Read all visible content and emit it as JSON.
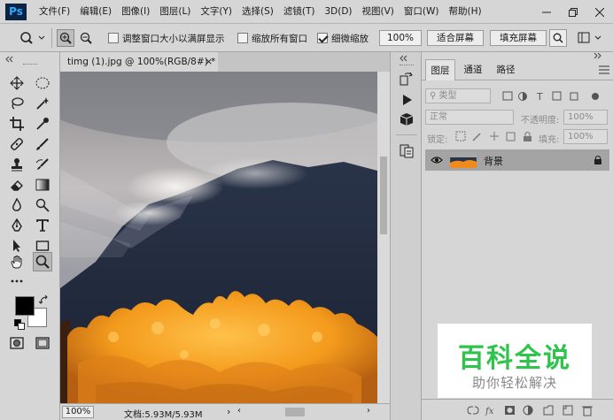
{
  "app": {
    "logo": "Ps"
  },
  "menu": [
    "文件(F)",
    "编辑(E)",
    "图像(I)",
    "图层(L)",
    "文字(Y)",
    "选择(S)",
    "滤镜(T)",
    "3D(D)",
    "视图(V)",
    "窗口(W)",
    "帮助(H)"
  ],
  "options": {
    "resize_windows": "调整窗口大小以满屏显示",
    "resize_windows_checked": false,
    "zoom_all": "缩放所有窗口",
    "zoom_all_checked": false,
    "scrubby_zoom": "细微缩放",
    "scrubby_zoom_checked": true,
    "zoom_value": "100%",
    "fit_screen": "适合屏幕",
    "fill_screen": "填充屏幕"
  },
  "document": {
    "tab_title": "timg (1).jpg @ 100%(RGB/8#) *",
    "close_glyph": "×"
  },
  "status": {
    "zoom": "100%",
    "doc_label": "文档:5.93M/5.93M"
  },
  "layers_panel": {
    "tabs": [
      "图层",
      "通道",
      "路径"
    ],
    "filter_kind": "类型",
    "blend_mode": "正常",
    "opacity_label": "不透明度:",
    "opacity_value": "100%",
    "lock_label": "锁定:",
    "fill_label": "填充:",
    "fill_value": "100%",
    "layer_name": "背景"
  },
  "watermark": {
    "title": "百科全说",
    "subtitle": "助你轻松解决"
  },
  "colors": {
    "ui_bg": "#d6d6d6",
    "foreground": "#000000",
    "background": "#ffffff",
    "watermark_green": "#2fc34c",
    "ps_logo_bg": "#0b2443",
    "ps_logo_text": "#31a8ff"
  }
}
